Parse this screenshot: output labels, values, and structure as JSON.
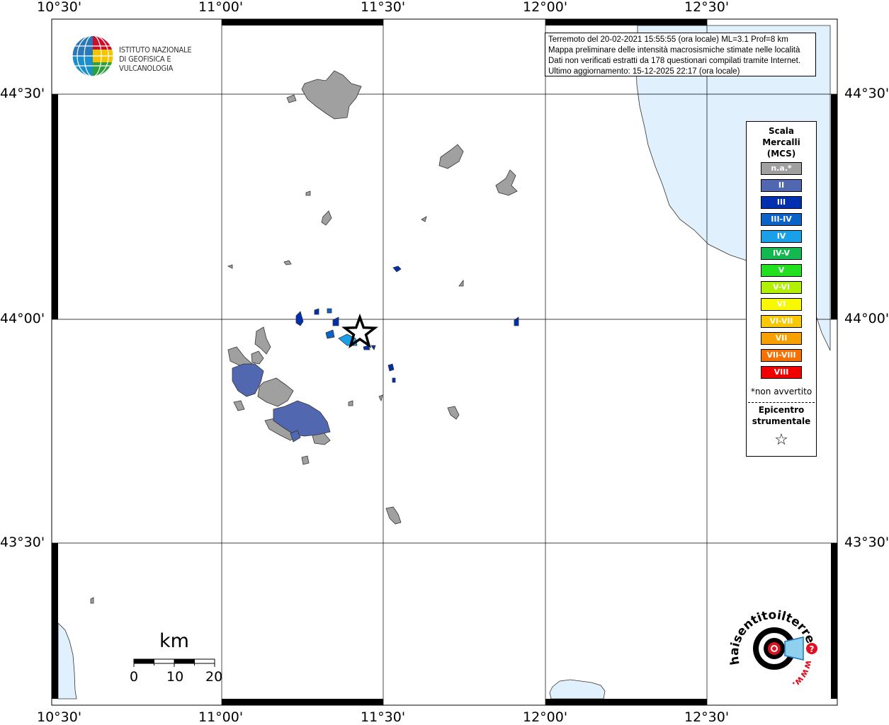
{
  "info_box": {
    "line1": "Terremoto del 20-02-2021 15:55:55 (ora locale) ML=3.1 Prof=8 km",
    "line2": "Mappa preliminare delle intensità macrosismiche stimate nelle località",
    "line3": "Dati non verificati estratti da 178 questionari compilati tramite Internet.",
    "line4": "Ultimo aggiornamento: 15-12-2025 22:17 (ora locale)"
  },
  "logo": {
    "line1": "ISTITUTO NAZIONALE",
    "line2": "DI GEOFISICA E VULCANOLOGIA"
  },
  "axes": {
    "lon_top": [
      "10°30'",
      "11°00'",
      "11°30'",
      "12°00'",
      "12°30'"
    ],
    "lon_bottom": [
      "10°30'",
      "11°00'",
      "11°30'",
      "12°00'",
      "12°30'"
    ],
    "lat_left": [
      "44°30'",
      "44°00'",
      "43°30'"
    ],
    "lat_right": [
      "44°30'",
      "44°00'",
      "43°30'"
    ]
  },
  "legend": {
    "title": [
      "Scala",
      "Mercalli",
      "(MCS)"
    ],
    "classes": [
      {
        "label": "n.a.*",
        "color": "#a0a0a0"
      },
      {
        "label": "II",
        "color": "#5168b0"
      },
      {
        "label": "III",
        "color": "#0030b0"
      },
      {
        "label": "III-IV",
        "color": "#0b62c8"
      },
      {
        "label": "IV",
        "color": "#1aa0e8"
      },
      {
        "label": "IV-V",
        "color": "#14b850"
      },
      {
        "label": "V",
        "color": "#20e020"
      },
      {
        "label": "V-VI",
        "color": "#b0f000"
      },
      {
        "label": "VI",
        "color": "#f8f800"
      },
      {
        "label": "VI-VII",
        "color": "#f8c800"
      },
      {
        "label": "VII",
        "color": "#f8a000"
      },
      {
        "label": "VII-VIII",
        "color": "#f87000"
      },
      {
        "label": "VIII",
        "color": "#f00000"
      }
    ],
    "note": "*non avvertito",
    "epicenter_label": [
      "Epicentro",
      "strumentale"
    ],
    "epicenter_symbol": "☆"
  },
  "scale_bar": {
    "unit": "km",
    "labels": [
      "0",
      "10",
      "20"
    ]
  },
  "hsit_logo": {
    "text": "haisentitoilterremoto.it",
    "url_text": "www."
  },
  "colors": {
    "sea": "#e0f0fc",
    "na": "#a0a0a0",
    "II": "#5168b0",
    "III": "#0030b0",
    "III-IV": "#0b62c8",
    "IV": "#1aa0e8"
  }
}
